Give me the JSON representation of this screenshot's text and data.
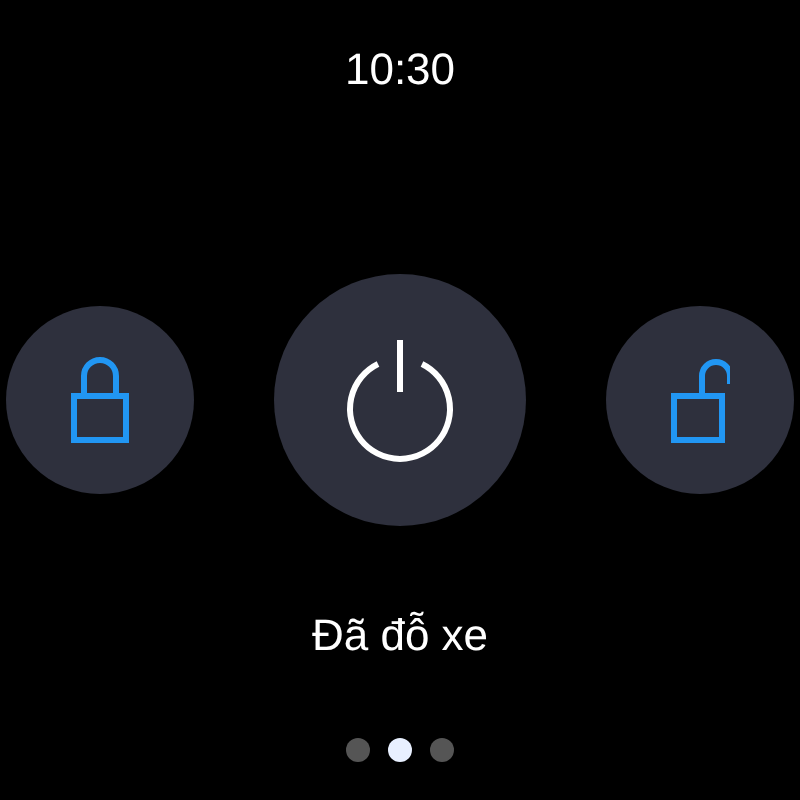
{
  "status_bar": {
    "time": "10:30"
  },
  "buttons": [
    {
      "kind": "lock"
    },
    {
      "kind": "power"
    },
    {
      "kind": "unlock"
    }
  ],
  "status_label": "Đã đỗ xe",
  "page_dots": [
    {
      "selected": false
    },
    {
      "selected": true
    },
    {
      "selected": false
    }
  ]
}
